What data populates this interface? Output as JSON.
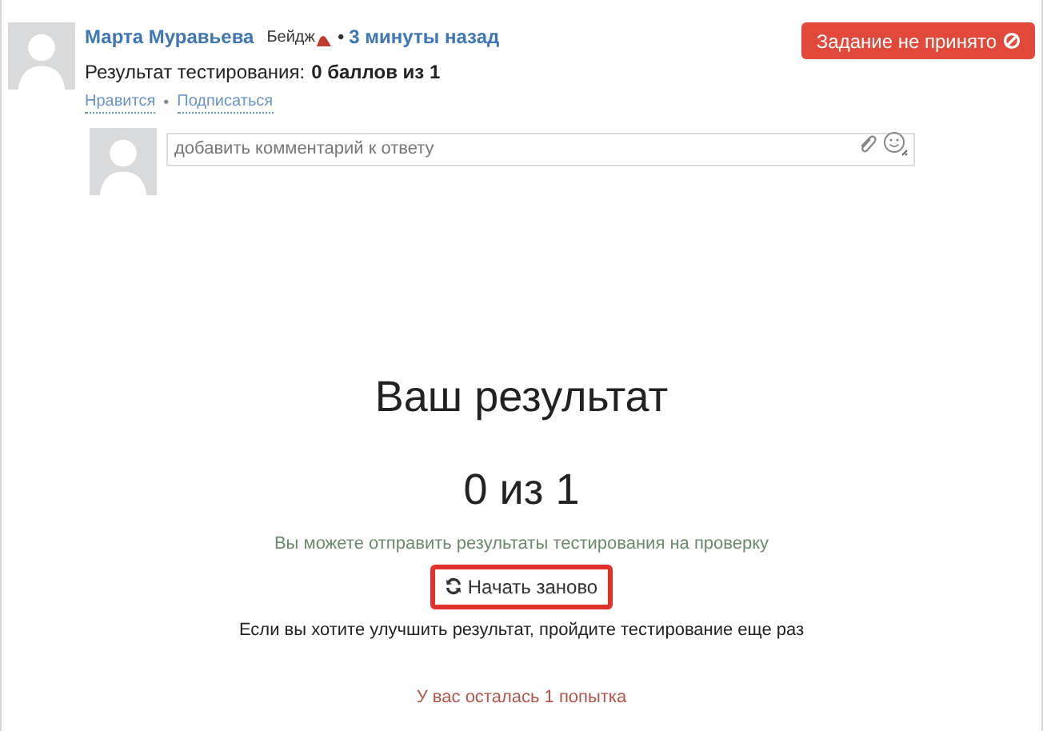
{
  "comment": {
    "author": "Марта Муравьева",
    "badge": "Бейдж",
    "time_separator": "•",
    "time": "3 минуты назад",
    "actions_separator": "•",
    "result_label": "Результат тестирования:",
    "result_value": "0 баллов из 1",
    "actions": [
      "Нравится",
      "Подписаться"
    ],
    "status": "Задание не принято"
  },
  "reply": {
    "placeholder": "добавить комментарий к ответу"
  },
  "summary": {
    "title": "Ваш результат",
    "score": "0 из 1",
    "submit_note": "Вы можете отправить результаты тестирования на проверку",
    "restart_button": "Начать заново",
    "restart_highlighted": true,
    "improve_note": "Если вы хотите улучшить результат, пройдите тестирование еще раз",
    "attempts_note": "У вас осталась 1 попытка"
  }
}
